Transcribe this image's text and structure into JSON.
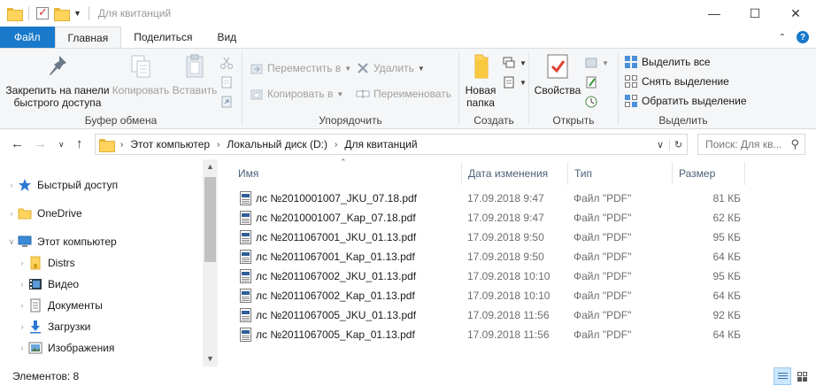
{
  "window": {
    "title": "Для квитанций"
  },
  "ribbon_tabs": [
    {
      "label": "Файл"
    },
    {
      "label": "Главная"
    },
    {
      "label": "Поделиться"
    },
    {
      "label": "Вид"
    }
  ],
  "clipboard": {
    "pin_label": "Закрепить на панели быстрого доступа",
    "copy_label": "Копировать",
    "paste_label": "Вставить",
    "group_label": "Буфер обмена"
  },
  "organize": {
    "move_label": "Переместить в",
    "copy_to_label": "Копировать в",
    "delete_label": "Удалить",
    "rename_label": "Переименовать",
    "group_label": "Упорядочить"
  },
  "create": {
    "new_folder_label": "Новая папка",
    "group_label": "Создать"
  },
  "open": {
    "properties_label": "Свойства",
    "group_label": "Открыть"
  },
  "select": {
    "select_all_label": "Выделить все",
    "deselect_label": "Снять выделение",
    "invert_label": "Обратить выделение",
    "group_label": "Выделить"
  },
  "address": {
    "crumbs": [
      "Этот компьютер",
      "Локальный диск (D:)",
      "Для квитанций"
    ]
  },
  "search": {
    "placeholder": "Поиск: Для кв..."
  },
  "nav_tree": [
    {
      "label": "Быстрый доступ",
      "icon": "star-icon"
    },
    {
      "label": "OneDrive",
      "icon": "folder-icon"
    },
    {
      "label": "Этот компьютер",
      "icon": "computer-icon"
    },
    {
      "label": "Distrs",
      "icon": "folder-icon"
    },
    {
      "label": "Видео",
      "icon": "video-icon"
    },
    {
      "label": "Документы",
      "icon": "documents-icon"
    },
    {
      "label": "Загрузки",
      "icon": "downloads-icon"
    },
    {
      "label": "Изображения",
      "icon": "pictures-icon"
    }
  ],
  "columns": {
    "name": "Имя",
    "date": "Дата изменения",
    "type": "Тип",
    "size": "Размер"
  },
  "files": [
    {
      "name": "лс №2010001007_JKU_07.18.pdf",
      "date": "17.09.2018 9:47",
      "type": "Файл \"PDF\"",
      "size": "81 КБ"
    },
    {
      "name": "лс №2010001007_Kap_07.18.pdf",
      "date": "17.09.2018 9:47",
      "type": "Файл \"PDF\"",
      "size": "62 КБ"
    },
    {
      "name": "лс №2011067001_JKU_01.13.pdf",
      "date": "17.09.2018 9:50",
      "type": "Файл \"PDF\"",
      "size": "95 КБ"
    },
    {
      "name": "лс №2011067001_Kap_01.13.pdf",
      "date": "17.09.2018 9:50",
      "type": "Файл \"PDF\"",
      "size": "64 КБ"
    },
    {
      "name": "лс №2011067002_JKU_01.13.pdf",
      "date": "17.09.2018 10:10",
      "type": "Файл \"PDF\"",
      "size": "95 КБ"
    },
    {
      "name": "лс №2011067002_Kap_01.13.pdf",
      "date": "17.09.2018 10:10",
      "type": "Файл \"PDF\"",
      "size": "64 КБ"
    },
    {
      "name": "лс №2011067005_JKU_01.13.pdf",
      "date": "17.09.2018 11:56",
      "type": "Файл \"PDF\"",
      "size": "92 КБ"
    },
    {
      "name": "лс №2011067005_Kap_01.13.pdf",
      "date": "17.09.2018 11:56",
      "type": "Файл \"PDF\"",
      "size": "64 КБ"
    }
  ],
  "status": {
    "count_text": "Элементов: 8"
  },
  "colors": {
    "accent": "#1979ca",
    "folder": "#ffd35c"
  }
}
